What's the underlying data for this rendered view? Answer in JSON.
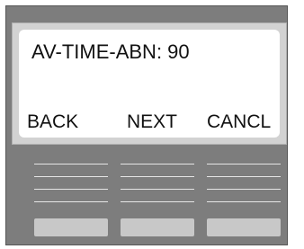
{
  "display": {
    "line1": "AV-TIME-ABN: 90"
  },
  "softkeys": [
    {
      "label": "BACK"
    },
    {
      "label": "NEXT"
    },
    {
      "label": "CANCL"
    }
  ]
}
